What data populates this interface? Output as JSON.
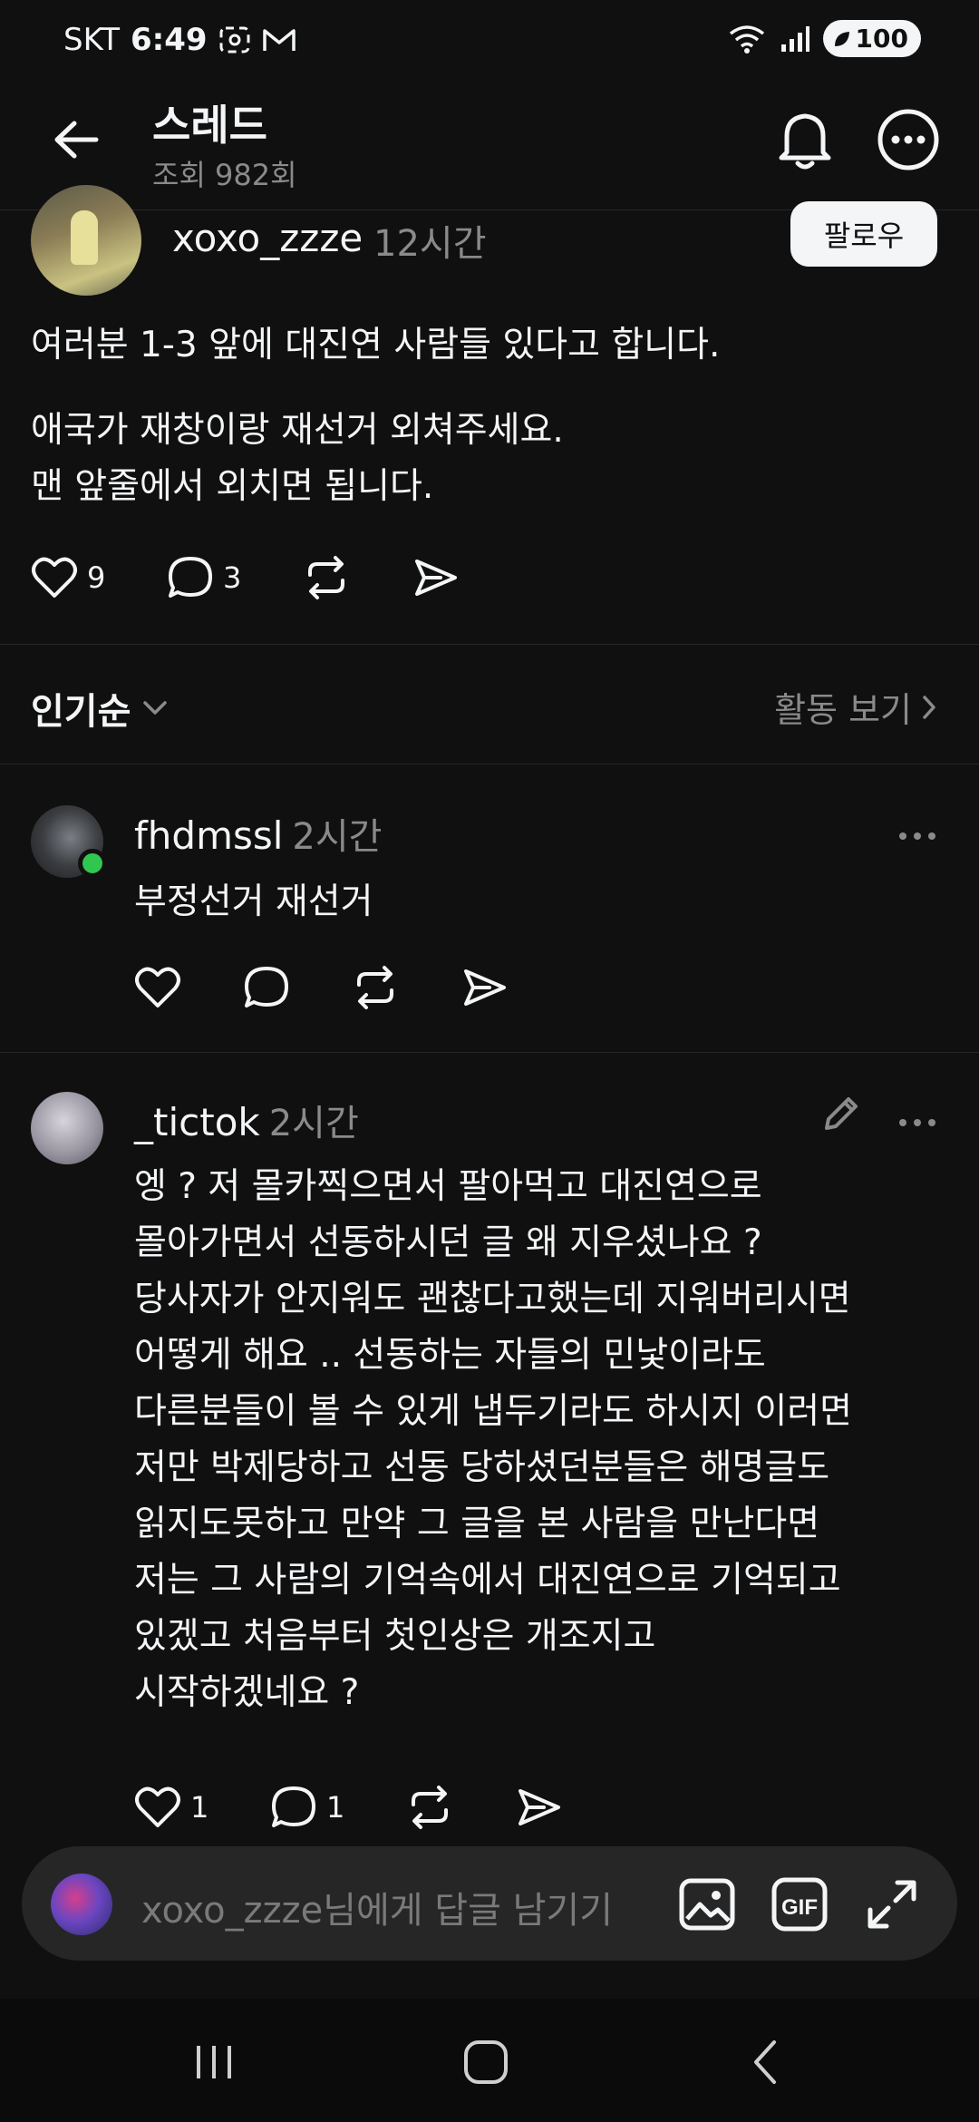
{
  "status_bar": {
    "carrier": "SKT",
    "time": "6:49",
    "battery": "100"
  },
  "header": {
    "title": "스레드",
    "views": "조회 982회"
  },
  "post": {
    "username": "xoxo_zzze",
    "time": "12시간",
    "follow_label": "팔로우",
    "paragraphs": [
      "여러분 1-3 앞에 대진연 사람들 있다고 합니다.",
      "애국가 재창이랑 재선거 외쳐주세요.\n맨 앞줄에서 외치면 됩니다."
    ],
    "likes": "9",
    "comments": "3"
  },
  "sort": {
    "label": "인기순",
    "activity_link": "활동 보기"
  },
  "replies": [
    {
      "username": "fhdmssl",
      "time": "2시간",
      "text": "부정선거 재선거",
      "likes": "",
      "comments": ""
    },
    {
      "username": "_tictok",
      "time": "2시간",
      "text": "엥 ? 저 몰카찍으면서 팔아먹고 대진연으로\n몰아가면서 선동하시던 글 왜 지우셨나요 ?\n당사자가 안지워도 괜찮다고했는데 지워버리시면\n어떻게 해요 .. 선동하는 자들의 민낯이라도\n다른분들이 볼 수 있게 냅두기라도 하시지 이러면\n저만 박제당하고 선동 당하셨던분들은 해명글도\n읽지도못하고 만약 그 글을 본 사람을 만난다면\n저는 그 사람의 기억속에서 대진연으로 기억되고\n있겠고 처음부터 첫인상은 개조지고\n시작하겠네요 ?",
      "likes": "1",
      "comments": "1"
    }
  ],
  "composer": {
    "placeholder": "xoxo_zzze님에게 답글 남기기"
  },
  "icons": {
    "back": "arrow-left-icon",
    "bell": "bell-icon",
    "more": "more-horizontal-icon",
    "heart": "heart-icon",
    "comment": "comment-icon",
    "repost": "repost-icon",
    "share": "send-icon",
    "image": "image-icon",
    "gif": "gif-icon",
    "expand": "expand-icon",
    "edit": "pencil-icon",
    "recents": "recents-icon",
    "home": "home-icon",
    "nav_back": "nav-back-icon"
  },
  "colors": {
    "background": "#101010",
    "text": "#f3f5f7",
    "muted": "#8a8a8a",
    "online": "#31c64f",
    "composer": "#262626"
  }
}
